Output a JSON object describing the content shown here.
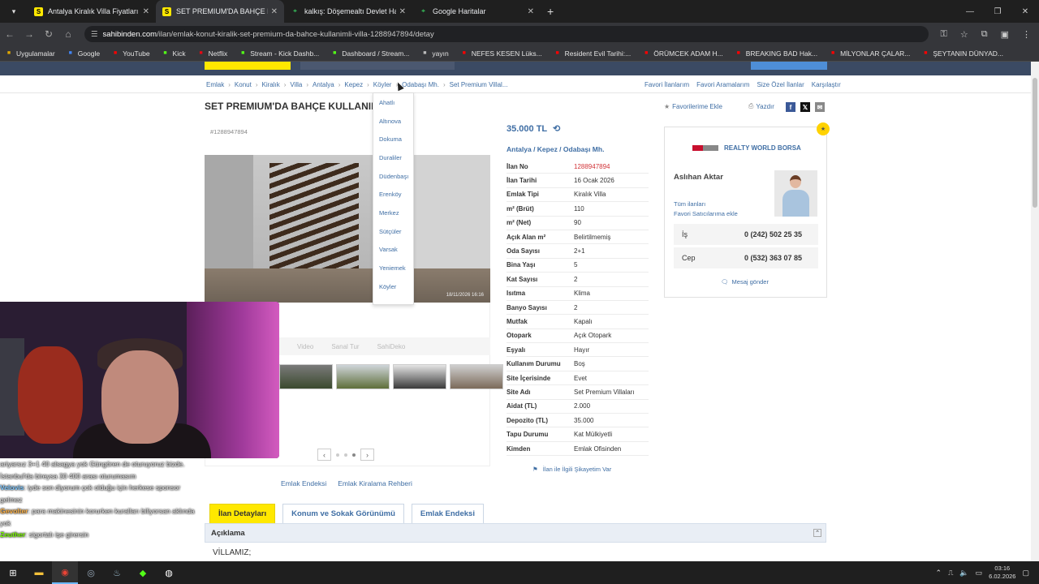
{
  "browser": {
    "tabs": [
      {
        "title": "Antalya Kiralık Villa Fiyatları sa",
        "favicon": "S",
        "favcolor": "#ffe800",
        "active": false
      },
      {
        "title": "SET PREMIUM'DA BAHÇE KULL",
        "favicon": "S",
        "favcolor": "#ffe800",
        "active": true
      },
      {
        "title": "kalkış: Döşemealtı Devlet Hasta",
        "favicon": "map-pin",
        "favcolor": "#34a853",
        "active": false
      },
      {
        "title": "Google Haritalar",
        "favicon": "map-pin",
        "favcolor": "#34a853",
        "active": false
      }
    ],
    "url_host": "sahibinden.com",
    "url_path": "/ilan/emlak-konut-kiralik-set-premium-da-bahce-kullanimli-villa-1288947894/detay",
    "bookmarks": [
      {
        "label": "Uygulamalar",
        "icon": "apps-icon",
        "color": "#e0a800"
      },
      {
        "label": "Google",
        "icon": "google-icon",
        "color": "#4285f4"
      },
      {
        "label": "YouTube",
        "icon": "youtube-icon",
        "color": "#ff0000"
      },
      {
        "label": "Kick",
        "icon": "kick-icon",
        "color": "#53fc18"
      },
      {
        "label": "Netflix",
        "icon": "netflix-icon",
        "color": "#e50914"
      },
      {
        "label": "Stream - Kick Dashb...",
        "icon": "kick-icon",
        "color": "#53fc18"
      },
      {
        "label": "Dashboard / Stream...",
        "icon": "dashboard-icon",
        "color": "#53fc18"
      },
      {
        "label": "yayın",
        "icon": "folder-icon",
        "color": "#bbbbbb"
      },
      {
        "label": "NEFES KESEN Lüks...",
        "icon": "youtube-icon",
        "color": "#ff0000"
      },
      {
        "label": "Resident Evil Tarihi:...",
        "icon": "youtube-icon",
        "color": "#ff0000"
      },
      {
        "label": "ÖRÜMCEK ADAM H...",
        "icon": "youtube-icon",
        "color": "#ff0000"
      },
      {
        "label": "BREAKING BAD Hak...",
        "icon": "youtube-icon",
        "color": "#ff0000"
      },
      {
        "label": "MİLYONLAR ÇALAR...",
        "icon": "youtube-icon",
        "color": "#ff0000"
      },
      {
        "label": "ŞEYTANIN DÜNYAD...",
        "icon": "youtube-icon",
        "color": "#ff0000"
      }
    ]
  },
  "breadcrumb": [
    "Emlak",
    "Konut",
    "Kiralık",
    "Villa",
    "Antalya",
    "Kepez",
    "Köyler",
    "Odabaşı Mh.",
    "Set Premium Villal..."
  ],
  "top_links": [
    "Favori İlanlarım",
    "Favori Aramalarım",
    "Size Özel İlanlar",
    "Karşılaştır"
  ],
  "listing": {
    "title": "SET PREMIUM'DA BAHÇE KULLANIM",
    "id": "#1288947894",
    "price": "35.000 TL",
    "location": "Antalya  /  Kepez  /  Odabaşı Mh.",
    "favorite": "Favorilerime Ekle",
    "print": "Yazdır",
    "photo_stamp": "18/11/2026 16:16",
    "media_tabs": [
      "Video",
      "Sanal Tur",
      "SahiDeko"
    ],
    "complaint": "İlan ile İlgili Şikayetim Var",
    "details": [
      {
        "k": "İlan No",
        "v": "1288947894",
        "red": true
      },
      {
        "k": "İlan Tarihi",
        "v": "16 Ocak 2026"
      },
      {
        "k": "Emlak Tipi",
        "v": "Kiralık Villa"
      },
      {
        "k": "m² (Brüt)",
        "v": "110"
      },
      {
        "k": "m² (Net)",
        "v": "90"
      },
      {
        "k": "Açık Alan m²",
        "v": "Belirtilmemiş"
      },
      {
        "k": "Oda Sayısı",
        "v": "2+1"
      },
      {
        "k": "Bina Yaşı",
        "v": "5"
      },
      {
        "k": "Kat Sayısı",
        "v": "2"
      },
      {
        "k": "Isıtma",
        "v": "Klima"
      },
      {
        "k": "Banyo Sayısı",
        "v": "2"
      },
      {
        "k": "Mutfak",
        "v": "Kapalı"
      },
      {
        "k": "Otopark",
        "v": "Açık Otopark"
      },
      {
        "k": "Eşyalı",
        "v": "Hayır"
      },
      {
        "k": "Kullanım Durumu",
        "v": "Boş"
      },
      {
        "k": "Site İçerisinde",
        "v": "Evet"
      },
      {
        "k": "Site Adı",
        "v": "Set Premium Villaları"
      },
      {
        "k": "Aidat (TL)",
        "v": "2.000"
      },
      {
        "k": "Depozito (TL)",
        "v": "35.000"
      },
      {
        "k": "Tapu Durumu",
        "v": "Kat Mülkiyetli"
      },
      {
        "k": "Kimden",
        "v": "Emlak Ofisinden"
      }
    ]
  },
  "dropdown": [
    "Ahatlı",
    "Altınova",
    "Dokuma",
    "Duraliler",
    "Düdenbaşı",
    "Erenköy",
    "Merkez",
    "Sütçüler",
    "Varsak",
    "Yeniemek",
    "Köyler"
  ],
  "seller": {
    "agency": "REALTY WORLD BORSA",
    "agent": "Aslıhan Aktar",
    "links": [
      "Tüm ilanları",
      "Favori Satıcılarıma ekle"
    ],
    "phones": [
      {
        "label": "İş",
        "number": "0 (242) 502 25 35"
      },
      {
        "label": "Cep",
        "number": "0 (532) 363 07 85"
      }
    ],
    "message": "Mesaj gönder"
  },
  "guides": [
    "Emlak Endeksi",
    "Emlak Kiralama Rehberi"
  ],
  "bottom_tabs": [
    "İlan Detayları",
    "Konum ve Sokak Görünümü",
    "Emlak Endeksi"
  ],
  "description": {
    "header": "Açıklama",
    "text": "VİLLAMIZ;"
  },
  "chat": [
    {
      "user": "",
      "text": "ariyarsız 3+1 40 alsagya yok Güngören de oturuyoruz bizde. İstanbul'da bireysa 30 400 arası oturumasım",
      "color": "#ddd"
    },
    {
      "user": "Velovis",
      "text": ": iyde son diyorum çok olduğu için herkese sponsor gelmez",
      "color": "#7ec8ff"
    },
    {
      "user": "Gevolter",
      "text": ": para makinesinin korurken kuralları biliyorsan aklında yok",
      "color": "#ffb347"
    },
    {
      "user": "Zeuther",
      "text": ": sigortalı işe girersin",
      "color": "#7cfc00"
    }
  ],
  "clock": {
    "time": "03:16",
    "date": "6.02.2026"
  }
}
